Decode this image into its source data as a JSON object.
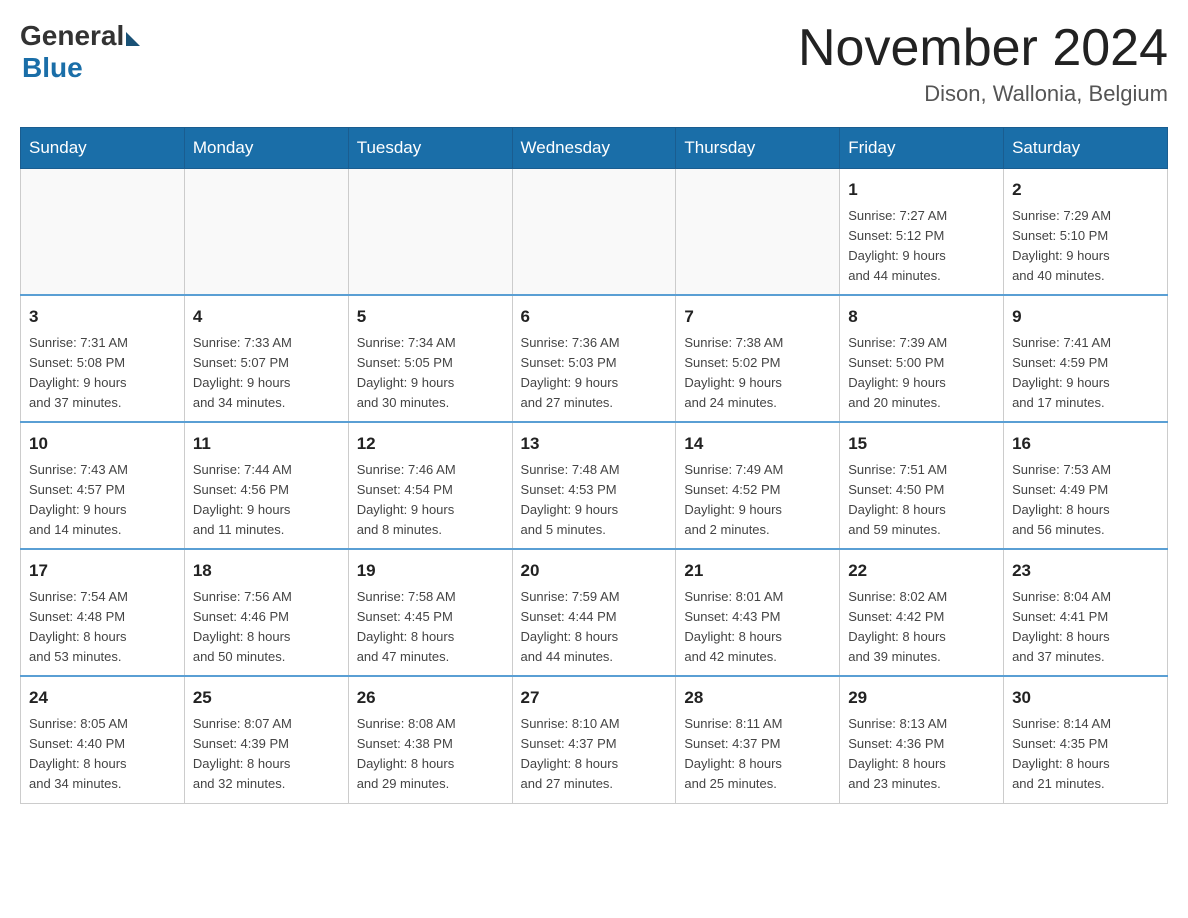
{
  "header": {
    "logo_general": "General",
    "logo_blue": "Blue",
    "month_title": "November 2024",
    "location": "Dison, Wallonia, Belgium"
  },
  "weekdays": [
    "Sunday",
    "Monday",
    "Tuesday",
    "Wednesday",
    "Thursday",
    "Friday",
    "Saturday"
  ],
  "weeks": [
    [
      {
        "day": "",
        "info": ""
      },
      {
        "day": "",
        "info": ""
      },
      {
        "day": "",
        "info": ""
      },
      {
        "day": "",
        "info": ""
      },
      {
        "day": "",
        "info": ""
      },
      {
        "day": "1",
        "info": "Sunrise: 7:27 AM\nSunset: 5:12 PM\nDaylight: 9 hours\nand 44 minutes."
      },
      {
        "day": "2",
        "info": "Sunrise: 7:29 AM\nSunset: 5:10 PM\nDaylight: 9 hours\nand 40 minutes."
      }
    ],
    [
      {
        "day": "3",
        "info": "Sunrise: 7:31 AM\nSunset: 5:08 PM\nDaylight: 9 hours\nand 37 minutes."
      },
      {
        "day": "4",
        "info": "Sunrise: 7:33 AM\nSunset: 5:07 PM\nDaylight: 9 hours\nand 34 minutes."
      },
      {
        "day": "5",
        "info": "Sunrise: 7:34 AM\nSunset: 5:05 PM\nDaylight: 9 hours\nand 30 minutes."
      },
      {
        "day": "6",
        "info": "Sunrise: 7:36 AM\nSunset: 5:03 PM\nDaylight: 9 hours\nand 27 minutes."
      },
      {
        "day": "7",
        "info": "Sunrise: 7:38 AM\nSunset: 5:02 PM\nDaylight: 9 hours\nand 24 minutes."
      },
      {
        "day": "8",
        "info": "Sunrise: 7:39 AM\nSunset: 5:00 PM\nDaylight: 9 hours\nand 20 minutes."
      },
      {
        "day": "9",
        "info": "Sunrise: 7:41 AM\nSunset: 4:59 PM\nDaylight: 9 hours\nand 17 minutes."
      }
    ],
    [
      {
        "day": "10",
        "info": "Sunrise: 7:43 AM\nSunset: 4:57 PM\nDaylight: 9 hours\nand 14 minutes."
      },
      {
        "day": "11",
        "info": "Sunrise: 7:44 AM\nSunset: 4:56 PM\nDaylight: 9 hours\nand 11 minutes."
      },
      {
        "day": "12",
        "info": "Sunrise: 7:46 AM\nSunset: 4:54 PM\nDaylight: 9 hours\nand 8 minutes."
      },
      {
        "day": "13",
        "info": "Sunrise: 7:48 AM\nSunset: 4:53 PM\nDaylight: 9 hours\nand 5 minutes."
      },
      {
        "day": "14",
        "info": "Sunrise: 7:49 AM\nSunset: 4:52 PM\nDaylight: 9 hours\nand 2 minutes."
      },
      {
        "day": "15",
        "info": "Sunrise: 7:51 AM\nSunset: 4:50 PM\nDaylight: 8 hours\nand 59 minutes."
      },
      {
        "day": "16",
        "info": "Sunrise: 7:53 AM\nSunset: 4:49 PM\nDaylight: 8 hours\nand 56 minutes."
      }
    ],
    [
      {
        "day": "17",
        "info": "Sunrise: 7:54 AM\nSunset: 4:48 PM\nDaylight: 8 hours\nand 53 minutes."
      },
      {
        "day": "18",
        "info": "Sunrise: 7:56 AM\nSunset: 4:46 PM\nDaylight: 8 hours\nand 50 minutes."
      },
      {
        "day": "19",
        "info": "Sunrise: 7:58 AM\nSunset: 4:45 PM\nDaylight: 8 hours\nand 47 minutes."
      },
      {
        "day": "20",
        "info": "Sunrise: 7:59 AM\nSunset: 4:44 PM\nDaylight: 8 hours\nand 44 minutes."
      },
      {
        "day": "21",
        "info": "Sunrise: 8:01 AM\nSunset: 4:43 PM\nDaylight: 8 hours\nand 42 minutes."
      },
      {
        "day": "22",
        "info": "Sunrise: 8:02 AM\nSunset: 4:42 PM\nDaylight: 8 hours\nand 39 minutes."
      },
      {
        "day": "23",
        "info": "Sunrise: 8:04 AM\nSunset: 4:41 PM\nDaylight: 8 hours\nand 37 minutes."
      }
    ],
    [
      {
        "day": "24",
        "info": "Sunrise: 8:05 AM\nSunset: 4:40 PM\nDaylight: 8 hours\nand 34 minutes."
      },
      {
        "day": "25",
        "info": "Sunrise: 8:07 AM\nSunset: 4:39 PM\nDaylight: 8 hours\nand 32 minutes."
      },
      {
        "day": "26",
        "info": "Sunrise: 8:08 AM\nSunset: 4:38 PM\nDaylight: 8 hours\nand 29 minutes."
      },
      {
        "day": "27",
        "info": "Sunrise: 8:10 AM\nSunset: 4:37 PM\nDaylight: 8 hours\nand 27 minutes."
      },
      {
        "day": "28",
        "info": "Sunrise: 8:11 AM\nSunset: 4:37 PM\nDaylight: 8 hours\nand 25 minutes."
      },
      {
        "day": "29",
        "info": "Sunrise: 8:13 AM\nSunset: 4:36 PM\nDaylight: 8 hours\nand 23 minutes."
      },
      {
        "day": "30",
        "info": "Sunrise: 8:14 AM\nSunset: 4:35 PM\nDaylight: 8 hours\nand 21 minutes."
      }
    ]
  ]
}
